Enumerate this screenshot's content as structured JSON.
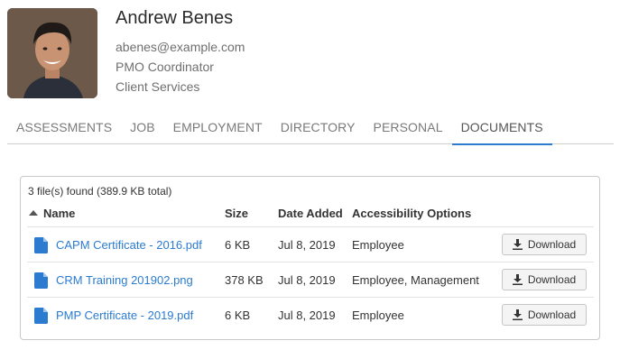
{
  "profile": {
    "name": "Andrew Benes",
    "email": "abenes@example.com",
    "title": "PMO Coordinator",
    "department": "Client Services"
  },
  "tabs": [
    {
      "label": "ASSESSMENTS",
      "active": false
    },
    {
      "label": "JOB",
      "active": false
    },
    {
      "label": "EMPLOYMENT",
      "active": false
    },
    {
      "label": "DIRECTORY",
      "active": false
    },
    {
      "label": "PERSONAL",
      "active": false
    },
    {
      "label": "DOCUMENTS",
      "active": true
    }
  ],
  "documents": {
    "summary": "3 file(s) found (389.9 KB total)",
    "columns": [
      "Name",
      "Size",
      "Date Added",
      "Accessibility Options"
    ],
    "sort_indicator": "ascending",
    "files": [
      {
        "name": "CAPM Certificate - 2016.pdf",
        "size": "6 KB",
        "date_added": "Jul 8, 2019",
        "accessibility": "Employee",
        "icon": "file-icon",
        "action": "Download"
      },
      {
        "name": "CRM Training 201902.png",
        "size": "378 KB",
        "date_added": "Jul 8, 2019",
        "accessibility": "Employee, Management",
        "icon": "file-icon",
        "action": "Download"
      },
      {
        "name": "PMP Certificate - 2019.pdf",
        "size": "6 KB",
        "date_added": "Jul 8, 2019",
        "accessibility": "Employee",
        "icon": "file-icon",
        "action": "Download"
      }
    ]
  },
  "colors": {
    "accent": "#2b7bd0",
    "text": "#333333",
    "muted": "#6f6f6f"
  }
}
